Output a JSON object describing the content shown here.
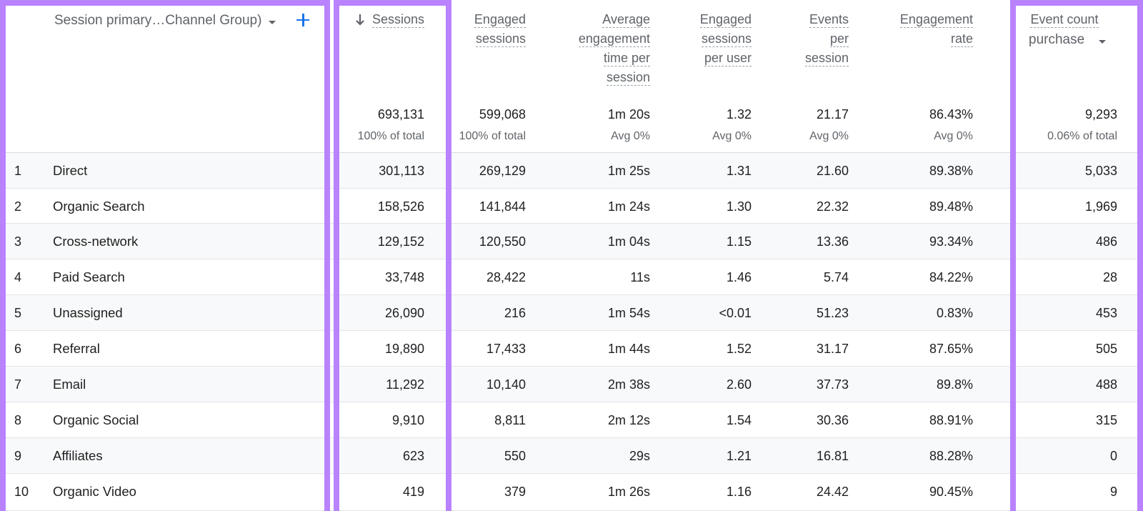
{
  "dimension_header": {
    "label": "Session primary…Channel Group)",
    "dropdown_icon": "caret-down-icon",
    "add_icon": "plus-icon"
  },
  "columns": {
    "sessions": {
      "lines": [
        "Sessions"
      ],
      "sort_icon": "arrow-down-icon",
      "total": "693,131",
      "sub": "100% of total"
    },
    "engaged_sessions": {
      "lines": [
        "Engaged",
        "sessions"
      ],
      "total": "599,068",
      "sub": "100% of total"
    },
    "avg_engagement_time": {
      "lines": [
        "Average",
        "engagement",
        "time per",
        "session"
      ],
      "total": "1m 20s",
      "sub": "Avg 0%"
    },
    "engaged_sessions_per_user": {
      "lines": [
        "Engaged",
        "sessions",
        "per user"
      ],
      "total": "1.32",
      "sub": "Avg 0%"
    },
    "events_per_session": {
      "lines": [
        "Events",
        "per",
        "session"
      ],
      "total": "21.17",
      "sub": "Avg 0%"
    },
    "engagement_rate": {
      "lines": [
        "Engagement",
        "rate"
      ],
      "total": "86.43%",
      "sub": "Avg 0%"
    },
    "event_count": {
      "lines": [
        "Event count"
      ],
      "filter_value": "purchase",
      "total": "9,293",
      "sub": "0.06% of total"
    }
  },
  "rows": [
    {
      "index": "1",
      "channel": "Direct",
      "sessions": "301,113",
      "engaged_sessions": "269,129",
      "avg_engagement_time": "1m 25s",
      "engaged_sessions_per_user": "1.31",
      "events_per_session": "21.60",
      "engagement_rate": "89.38%",
      "event_count": "5,033"
    },
    {
      "index": "2",
      "channel": "Organic Search",
      "sessions": "158,526",
      "engaged_sessions": "141,844",
      "avg_engagement_time": "1m 24s",
      "engaged_sessions_per_user": "1.30",
      "events_per_session": "22.32",
      "engagement_rate": "89.48%",
      "event_count": "1,969"
    },
    {
      "index": "3",
      "channel": "Cross-network",
      "sessions": "129,152",
      "engaged_sessions": "120,550",
      "avg_engagement_time": "1m 04s",
      "engaged_sessions_per_user": "1.15",
      "events_per_session": "13.36",
      "engagement_rate": "93.34%",
      "event_count": "486"
    },
    {
      "index": "4",
      "channel": "Paid Search",
      "sessions": "33,748",
      "engaged_sessions": "28,422",
      "avg_engagement_time": "11s",
      "engaged_sessions_per_user": "1.46",
      "events_per_session": "5.74",
      "engagement_rate": "84.22%",
      "event_count": "28"
    },
    {
      "index": "5",
      "channel": "Unassigned",
      "sessions": "26,090",
      "engaged_sessions": "216",
      "avg_engagement_time": "1m 54s",
      "engaged_sessions_per_user": "<0.01",
      "events_per_session": "51.23",
      "engagement_rate": "0.83%",
      "event_count": "453"
    },
    {
      "index": "6",
      "channel": "Referral",
      "sessions": "19,890",
      "engaged_sessions": "17,433",
      "avg_engagement_time": "1m 44s",
      "engaged_sessions_per_user": "1.52",
      "events_per_session": "31.17",
      "engagement_rate": "87.65%",
      "event_count": "505"
    },
    {
      "index": "7",
      "channel": "Email",
      "sessions": "11,292",
      "engaged_sessions": "10,140",
      "avg_engagement_time": "2m 38s",
      "engaged_sessions_per_user": "2.60",
      "events_per_session": "37.73",
      "engagement_rate": "89.8%",
      "event_count": "488"
    },
    {
      "index": "8",
      "channel": "Organic Social",
      "sessions": "9,910",
      "engaged_sessions": "8,811",
      "avg_engagement_time": "2m 12s",
      "engaged_sessions_per_user": "1.54",
      "events_per_session": "30.36",
      "engagement_rate": "88.91%",
      "event_count": "315"
    },
    {
      "index": "9",
      "channel": "Affiliates",
      "sessions": "623",
      "engaged_sessions": "550",
      "avg_engagement_time": "29s",
      "engaged_sessions_per_user": "1.21",
      "events_per_session": "16.81",
      "engagement_rate": "88.28%",
      "event_count": "0"
    },
    {
      "index": "10",
      "channel": "Organic Video",
      "sessions": "419",
      "engaged_sessions": "379",
      "avg_engagement_time": "1m 26s",
      "engaged_sessions_per_user": "1.16",
      "events_per_session": "24.42",
      "engagement_rate": "90.45%",
      "event_count": "9"
    }
  ],
  "colors": {
    "highlight_frame": "#b983ff",
    "accent_blue": "#1a73e8",
    "row_shaded": "#f8f9fa"
  }
}
